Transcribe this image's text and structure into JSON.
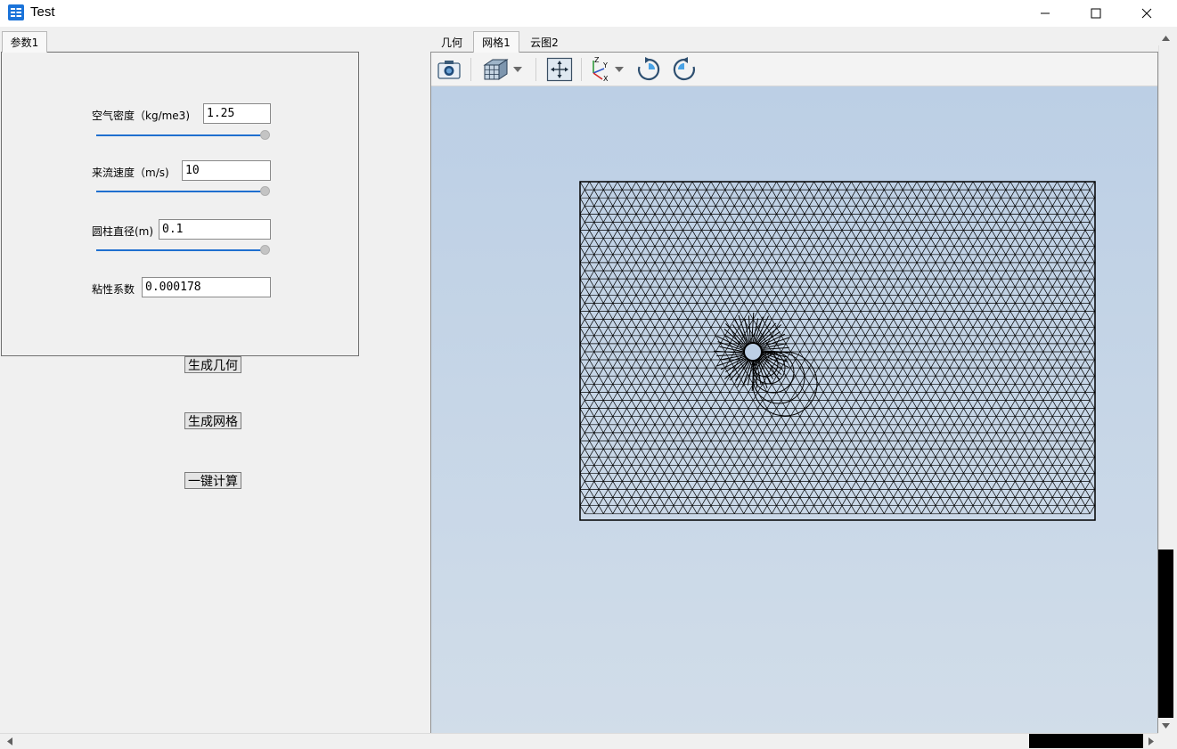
{
  "window": {
    "title": "Test",
    "icon": "table-app-icon"
  },
  "window_controls": {
    "minimize_icon": "minimize-icon",
    "maximize_icon": "maximize-icon",
    "close_icon": "close-icon"
  },
  "left_panel": {
    "tab_label": "参数1",
    "params": [
      {
        "label": "空气密度（kg/me3)",
        "value": "1.25",
        "slider_fraction": 1.0
      },
      {
        "label": "来流速度（m/s)",
        "value": "10",
        "slider_fraction": 1.0
      },
      {
        "label": "圆柱直径(m)",
        "value": "0.1",
        "slider_fraction": 1.0
      },
      {
        "label": "粘性系数",
        "value": "0.000178"
      }
    ]
  },
  "actions": {
    "geometry": "生成几何",
    "mesh": "生成网格",
    "compute": "一键计算"
  },
  "right_tabs": [
    "几何",
    "网格1",
    "云图2"
  ],
  "active_tab": "网格1",
  "toolbar": {
    "icons": [
      "camera-icon",
      "cube-view-icon",
      "dropdown-arrow-icon",
      "fit-view-icon",
      "axes-icon",
      "dropdown-arrow-icon",
      "rotate-cw-icon",
      "rotate-ccw-icon"
    ],
    "axis_labels": {
      "z": "Z",
      "y": "Y",
      "x": "X"
    }
  },
  "colors": {
    "accent": "#1f6fcf",
    "viewport_top": "#bccfe5",
    "viewport_bottom": "#d1dde9",
    "mesh_line": "#000000",
    "cylinder_fill": "#bccfe5"
  }
}
